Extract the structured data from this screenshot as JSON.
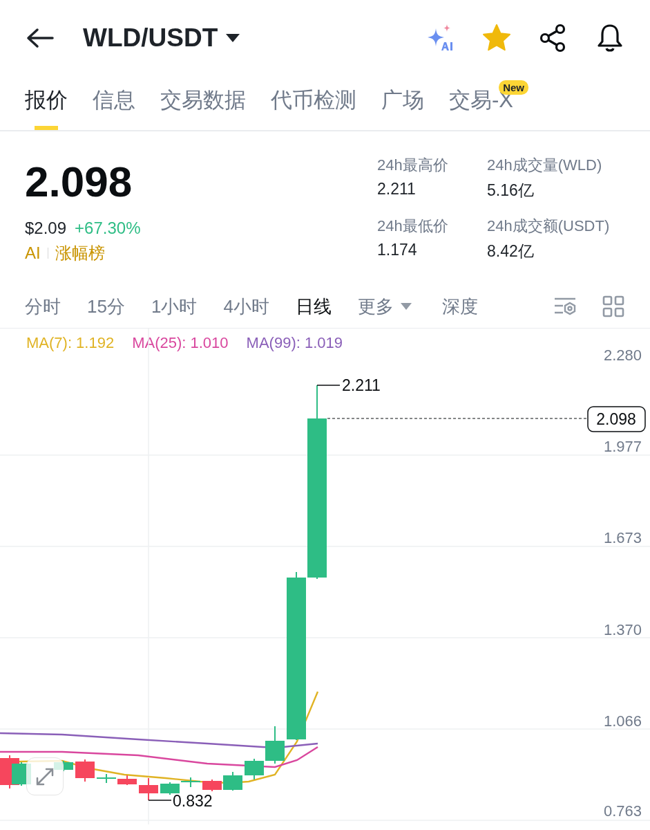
{
  "header": {
    "title": "WLD/USDT",
    "favorited": true
  },
  "tabs": [
    {
      "label": "报价",
      "selected": true
    },
    {
      "label": "信息",
      "selected": false
    },
    {
      "label": "交易数据",
      "selected": false
    },
    {
      "label": "代币检测",
      "selected": false
    },
    {
      "label": "广场",
      "selected": false
    },
    {
      "label": "交易-X",
      "selected": false,
      "badge": "New"
    }
  ],
  "quote": {
    "price": "2.098",
    "usd": "$2.09",
    "change": "+67.30%",
    "tag_prefix": "AI",
    "tag": "涨幅榜"
  },
  "stats": [
    {
      "label": "24h最高价",
      "value": "2.211"
    },
    {
      "label": "24h成交量(WLD)",
      "value": "5.16亿"
    },
    {
      "label": "24h最低价",
      "value": "1.174"
    },
    {
      "label": "24h成交额(USDT)",
      "value": "8.42亿"
    }
  ],
  "intervals": [
    {
      "label": "分时",
      "selected": false,
      "kind": "plain"
    },
    {
      "label": "15分",
      "selected": false,
      "kind": "plain"
    },
    {
      "label": "1小时",
      "selected": false,
      "kind": "plain"
    },
    {
      "label": "4小时",
      "selected": false,
      "kind": "plain"
    },
    {
      "label": "日线",
      "selected": true,
      "kind": "plain"
    },
    {
      "label": "更多",
      "selected": false,
      "kind": "dropdown"
    },
    {
      "label": "深度",
      "selected": false,
      "kind": "plain"
    }
  ],
  "ma": [
    {
      "label": "MA(7): 1.192",
      "color": "#e0b324"
    },
    {
      "label": "MA(25): 1.010",
      "color": "#d9479e"
    },
    {
      "label": "MA(99): 1.019",
      "color": "#8a5fb8"
    }
  ],
  "chart": {
    "price_axis": [
      "2.280",
      "1.977",
      "1.673",
      "1.370",
      "1.066",
      "0.763"
    ],
    "high_label": "2.211",
    "low_label": "0.832",
    "current_price": "2.098"
  }
}
